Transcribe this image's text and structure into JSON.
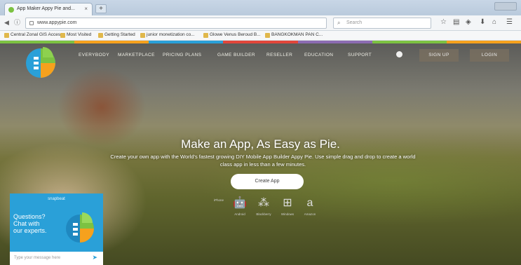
{
  "browser": {
    "tab_title": "App Maker Appy Pie and...",
    "tab_close": "×",
    "new_tab": "+",
    "address": "www.appypie.com",
    "search_placeholder": "Search",
    "bookmarks": [
      "Central Zonal GIS Acces...",
      "Most Visited",
      "Getting Started",
      "junior monetization co...",
      "Glowe Venus Beroud B...",
      "BANGKOKMAN PAN C..."
    ]
  },
  "site": {
    "brand_colors": [
      "#7cc242",
      "#f6a11d",
      "#2aa0d8",
      "#e2463b",
      "#8c6bb1"
    ],
    "nav": [
      "EVERYBODY",
      "MARKETPLACE",
      "PRICING PLANS",
      "GAME BUILDER",
      "RESELLER",
      "EDUCATION",
      "SUPPORT"
    ],
    "signup_label": "SIGN UP",
    "login_label": "LOGIN",
    "headline": "Make an App, As Easy as Pie.",
    "subtext": "Create your own app with the World's fastest growing DIY Mobile App Builder Appy Pie. Use simple drag and drop to create a world class app in less than a few minutes.",
    "cta_label": "Create App",
    "platforms": [
      {
        "icon": "apple-icon",
        "glyph": "",
        "label": "iPhone"
      },
      {
        "icon": "android-icon",
        "glyph": "🤖",
        "label": "Android"
      },
      {
        "icon": "blackberry-icon",
        "glyph": "⁂",
        "label": "Blackberry"
      },
      {
        "icon": "windows-icon",
        "glyph": "⊞",
        "label": "Windows"
      },
      {
        "icon": "amazon-icon",
        "glyph": "a",
        "label": "Amazon"
      }
    ]
  },
  "chat": {
    "brand": "snapbeat",
    "line1": "Questions?",
    "line2": "Chat with",
    "line3": "our experts.",
    "input_placeholder": "Type your message here",
    "send_icon": "➤"
  }
}
